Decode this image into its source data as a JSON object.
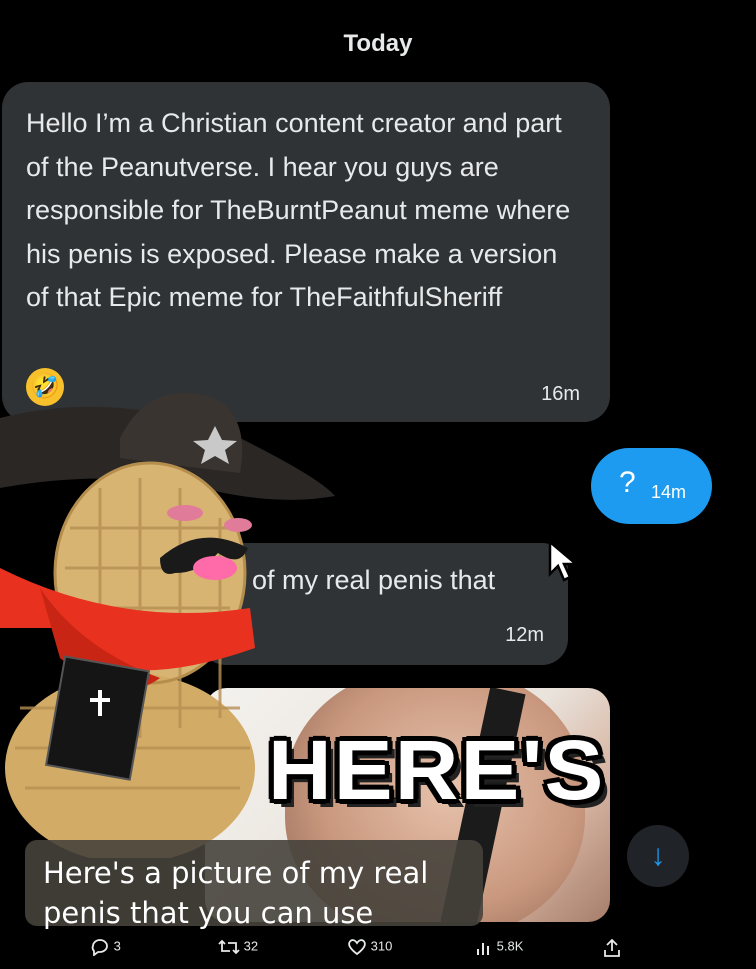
{
  "header": {
    "date": "Today"
  },
  "messages": [
    {
      "text": "Hello I’m a Christian content creator and part of the Peanutverse. I hear you guys are responsible for TheBurntPeanut meme where his penis is exposed. Please make a version of that Epic meme for TheFaithfulSheriff",
      "emoji": "🤣",
      "time": "16m"
    },
    {
      "text": "?",
      "time": "14m"
    },
    {
      "text": "of my real penis that",
      "time": "12m"
    }
  ],
  "media": {
    "overlay_text": "HERE'S"
  },
  "caption": {
    "line1": "Here's a picture of my real",
    "line2": "penis that you can use"
  },
  "scroll_button": {
    "icon": "arrow-down-icon",
    "glyph": "↓"
  },
  "actions": {
    "replies": "3",
    "reposts": "32",
    "likes": "310",
    "views": "5.8K"
  },
  "colors": {
    "accent": "#1d9bf0",
    "bubble_incoming": "#2f3336",
    "background": "#000000"
  }
}
